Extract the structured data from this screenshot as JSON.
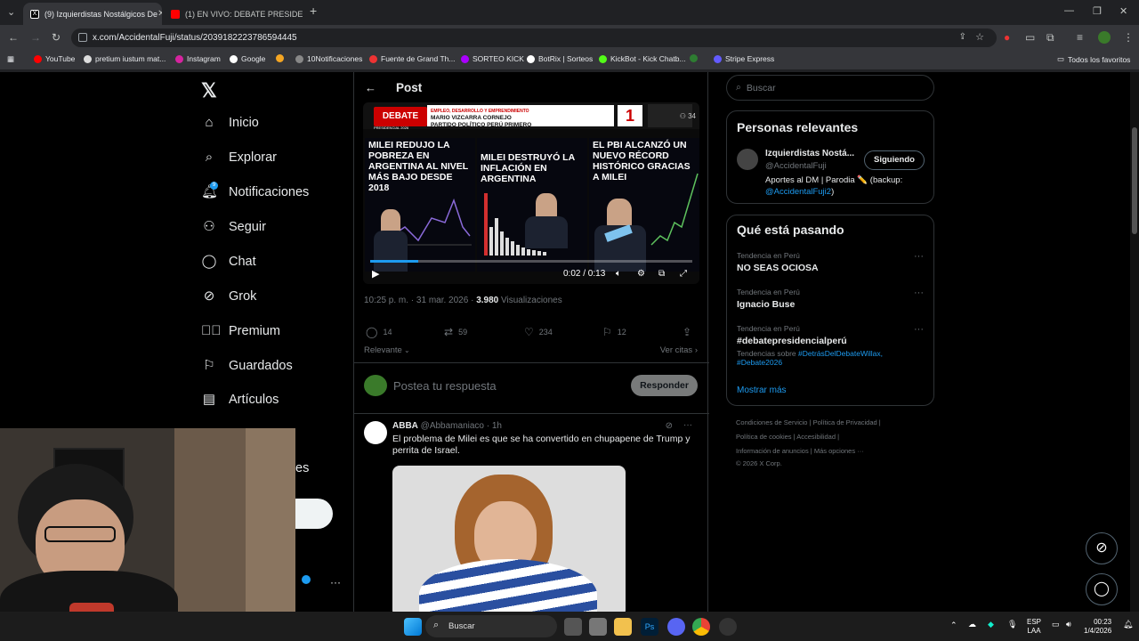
{
  "browser": {
    "tabs": [
      {
        "title": "(9) Izquierdistas Nostálgicos De",
        "active": true
      },
      {
        "title": "(1) EN VIVO: DEBATE PRESIDEN",
        "active": false
      }
    ],
    "url": "x.com/AccidentalFuji/status/2039182223786594445",
    "bookmarks": [
      "YouTube",
      "pretium iustum mat...",
      "Instagram",
      "Google",
      "10Notificaciones",
      "Fuente de Grand Th...",
      "SORTEO KICK",
      "BotRix | Sorteos",
      "KickBot - Kick Chatb...",
      "Stripe Express"
    ],
    "bookmarks_folder": "Todos los favoritos"
  },
  "nav": {
    "items": [
      {
        "label": "Inicio",
        "icon": "home-icon"
      },
      {
        "label": "Explorar",
        "icon": "search-icon"
      },
      {
        "label": "Notificaciones",
        "icon": "bell-icon",
        "badge": "9"
      },
      {
        "label": "Seguir",
        "icon": "follow-icon"
      },
      {
        "label": "Chat",
        "icon": "chat-icon"
      },
      {
        "label": "Grok",
        "icon": "grok-icon"
      },
      {
        "label": "Premium",
        "icon": "premium-icon"
      },
      {
        "label": "Guardados",
        "icon": "bookmark-icon"
      },
      {
        "label": "Artículos",
        "icon": "articles-icon"
      }
    ],
    "partial_label": "es"
  },
  "post": {
    "header": "Post",
    "video": {
      "banner_logo": "DEBATE",
      "banner_logo_sub": "PRESIDENCIAL 2026",
      "banner_line1": "EMPLEO, DESARROLLO Y EMPRENDIMIENTO",
      "banner_line2": "MARIO VIZCARRA CORNEJO",
      "banner_line3": "PARTIDO POLÍTICO PERÚ PRIMERO",
      "banner_number": "1",
      "viewers": "34",
      "panel1": "MILEI REDUJO LA POBREZA EN ARGENTINA AL NIVEL MÁS BAJO DESDE 2018",
      "panel2": "MILEI DESTRUYÓ LA INFLACIÓN EN ARGENTINA",
      "panel3": "EL PBI ALCANZÓ UN NUEVO RÉCORD HISTÓRICO GRACIAS A MILEI",
      "time": "0:02 / 0:13",
      "progress": 0.15
    },
    "time": "10:25 p. m. · 31 mar. 2026 ·",
    "views_count": "3.980",
    "views_label": "Visualizaciones",
    "replies": "14",
    "reposts": "59",
    "likes": "234",
    "bookmarks": "12",
    "sort": "Relevante",
    "quotes": "Ver citas",
    "reply_placeholder": "Postea tu respuesta",
    "reply_button": "Responder"
  },
  "reply_tweet": {
    "name": "ABBA",
    "handle": "@Abbamaniaco · 1h",
    "text": "El problema de Milei es que se ha convertido en chupapene de Trump y perrita de Israel."
  },
  "sidebar": {
    "search_placeholder": "Buscar",
    "relevant_title": "Personas relevantes",
    "person_name": "Izquierdistas Nostá...",
    "person_handle": "@AccidentalFuji",
    "follow_button": "Siguiendo",
    "person_bio": "Aportes al DM | Parodia ✏️ (backup:",
    "person_bio_link": "@AccidentalFuji2",
    "person_bio_end": ")",
    "trends_title": "Qué está pasando",
    "trends": [
      {
        "category": "Tendencia en Perú",
        "name": "NO SEAS OCIOSA"
      },
      {
        "category": "Tendencia en Perú",
        "name": "Ignacio Buse"
      },
      {
        "category": "Tendencia en Perú",
        "name": "#debatepresidencialperú"
      }
    ],
    "trend_related_prefix": "Tendencias sobre",
    "trend_related_1": "#DetrásDelDebateWillax,",
    "trend_related_2": "#Debate2026",
    "show_more": "Mostrar más",
    "footer": [
      "Condiciones de Servicio  |  Política de Privacidad  |",
      "Política de cookies  |  Accesibilidad  |",
      "Información de anuncios  |  Más opciones ···",
      "© 2026 X Corp."
    ]
  },
  "taskbar": {
    "search": "Buscar",
    "lang1": "ESP",
    "lang2": "LAA",
    "time": "00:23",
    "date": "1/4/2026"
  },
  "colors": {
    "accent": "#1d9bf0",
    "bg": "#000000",
    "border": "#2f3336",
    "muted": "#71767b"
  }
}
